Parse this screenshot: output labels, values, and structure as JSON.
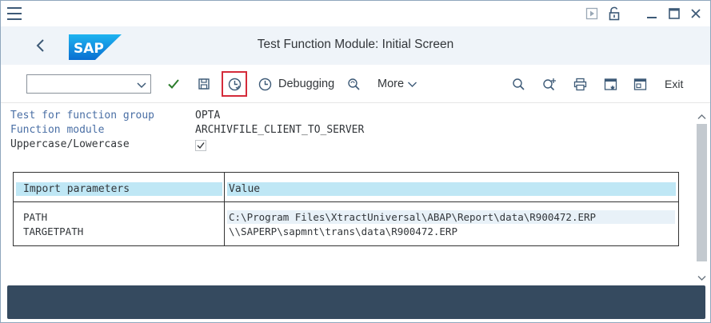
{
  "window": {
    "controls": [
      "play-icon",
      "unlock-icon",
      "minimize-icon",
      "maximize-icon",
      "close-icon"
    ]
  },
  "header": {
    "title": "Test Function Module: Initial Screen",
    "logo_text": "SAP"
  },
  "toolbar": {
    "command_field": {
      "value": "",
      "placeholder": ""
    },
    "debugging_label": "Debugging",
    "more_label": "More",
    "exit_label": "Exit"
  },
  "form": {
    "fields": [
      {
        "label": "Test for function group",
        "value": "OPTA"
      },
      {
        "label": "Function module",
        "value": "ARCHIVFILE_CLIENT_TO_SERVER"
      },
      {
        "label": "Uppercase/Lowercase",
        "checked": true
      }
    ]
  },
  "table": {
    "headers": [
      "Import parameters",
      "Value"
    ],
    "rows": [
      {
        "name": "PATH",
        "value": "C:\\Program Files\\XtractUniversal\\ABAP\\Report\\data\\R900472.ERP"
      },
      {
        "name": "TARGETPATH",
        "value": "\\\\SAPERP\\sapmnt\\trans\\data\\R900472.ERP"
      }
    ]
  },
  "colors": {
    "accent": "#3d5a77",
    "header_bg": "#eff4f9",
    "table_header_bg": "#bfe7f5",
    "highlight_border": "#d42b3a",
    "footer_bg": "#354a5f",
    "label_blue": "#4a6fa5",
    "check_green": "#2b7c2b"
  }
}
